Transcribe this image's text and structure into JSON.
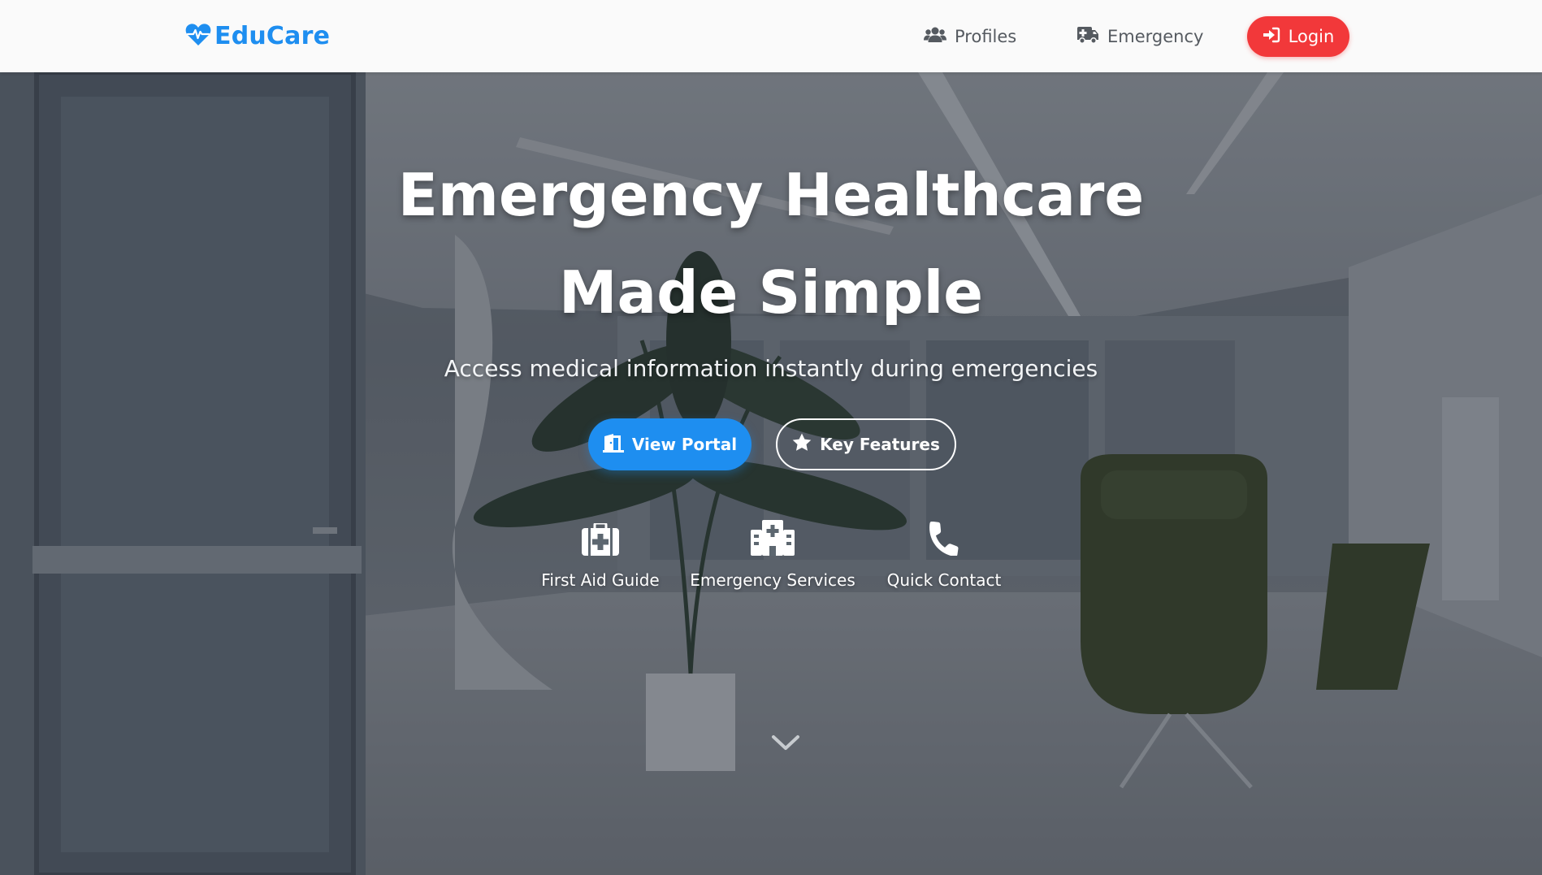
{
  "navbar": {
    "brand": "EduCare",
    "brand_icon": "heart-pulse-icon",
    "links": [
      {
        "label": "Profiles",
        "icon": "users-icon"
      },
      {
        "label": "Emergency",
        "icon": "ambulance-icon"
      }
    ],
    "login_label": "Login",
    "login_icon": "sign-in-icon"
  },
  "hero": {
    "title_line1": "Emergency Healthcare",
    "title_line2": "Made Simple",
    "subtitle": "Access medical information instantly during emergencies",
    "primary_button": {
      "label": "View Portal",
      "icon": "door-open-icon"
    },
    "secondary_button": {
      "label": "Key Features",
      "icon": "star-icon"
    },
    "features": [
      {
        "label": "First Aid Guide",
        "icon": "medkit-icon"
      },
      {
        "label": "Emergency Services",
        "icon": "hospital-icon"
      },
      {
        "label": "Quick Contact",
        "icon": "phone-icon"
      }
    ],
    "scroll_icon": "chevron-down-icon"
  },
  "colors": {
    "brand_blue": "#1e8ef0",
    "login_red": "#f2383a",
    "nav_text": "#555a60",
    "hero_overlay": "rgba(32,38,48,0.45)",
    "text_white": "#ffffff"
  }
}
